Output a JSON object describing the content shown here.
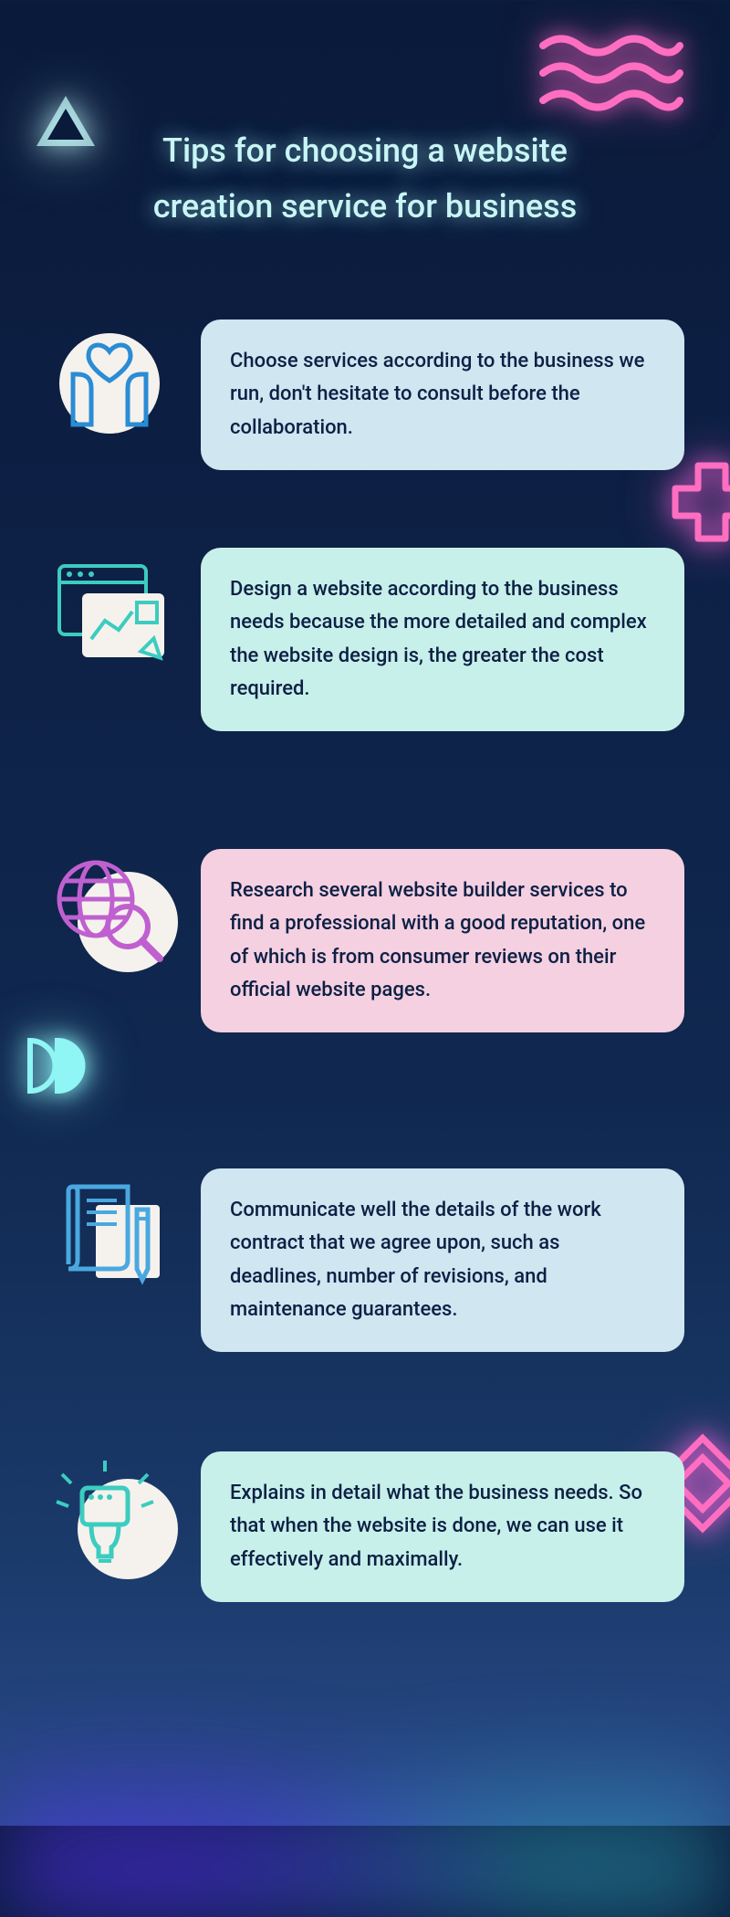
{
  "title": "Tips for choosing a website creation service for business",
  "tips": [
    {
      "text": "Choose services according to the business we run, don't hesitate to consult before the collaboration.",
      "card_class": "card-blue-light",
      "icon": "hands-heart"
    },
    {
      "text": "Design a website according to the business needs because the more detailed and complex the website design is, the greater the cost required.",
      "card_class": "card-cyan-light",
      "icon": "webpage-chart"
    },
    {
      "text": "Research several website builder services to find a professional with a good reputation, one of which is from consumer reviews on their official website pages.",
      "card_class": "card-pink-light",
      "icon": "globe-search"
    },
    {
      "text": "Communicate well the details of the work contract that we agree upon, such as deadlines, number of revisions, and maintenance guarantees.",
      "card_class": "card-blue-light",
      "icon": "document-pencil"
    },
    {
      "text": "Explains in detail what the business needs. So that when the website is done, we can use it effectively and maximally.",
      "card_class": "card-cyan-light",
      "icon": "lightbulb"
    }
  ]
}
